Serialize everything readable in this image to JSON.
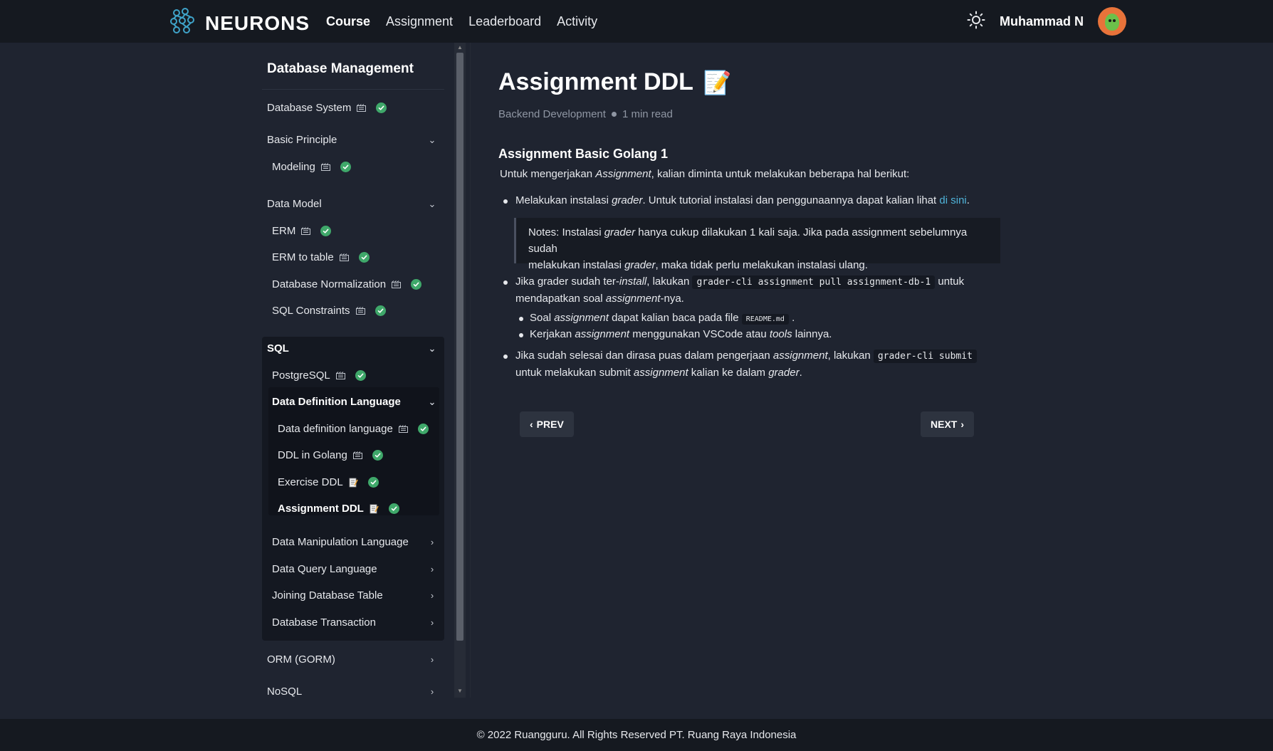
{
  "header": {
    "brand": "NEURONS",
    "nav": [
      "Course",
      "Assignment",
      "Leaderboard",
      "Activity"
    ],
    "active_nav": "Course",
    "user_name": "Muhammad N"
  },
  "sidebar": {
    "title": "Database Management",
    "items": {
      "database_system": "Database System",
      "basic_principle": "Basic Principle",
      "modeling": "Modeling",
      "data_model": "Data Model",
      "erm": "ERM",
      "erm_to_table": "ERM to table",
      "database_normalization": "Database Normalization",
      "sql_constraints": "SQL Constraints",
      "sql": "SQL",
      "postgresql": "PostgreSQL",
      "ddl": "Data Definition Language",
      "ddl_lesson": "Data definition language",
      "ddl_golang": "DDL in Golang",
      "exercise_ddl": "Exercise DDL",
      "assignment_ddl": "Assignment DDL",
      "dml": "Data Manipulation Language",
      "dql": "Data Query Language",
      "joining": "Joining Database Table",
      "transaction": "Database Transaction",
      "orm": "ORM (GORM)",
      "nosql": "NoSQL"
    }
  },
  "main": {
    "title": "Assignment DDL",
    "title_emoji": "📝",
    "category": "Backend Development",
    "read_time": "1 min read",
    "section_title": "Assignment Basic Golang 1",
    "intro_1": "Untuk mengerjakan ",
    "intro_em": "Assignment",
    "intro_2": ", kalian diminta untuk melakukan beberapa hal berikut:",
    "b1_1": "Melakukan instalasi ",
    "b1_em": "grader",
    "b1_2": ". Untuk tutorial instalasi dan penggunaannya dapat kalian lihat ",
    "b1_link": "di sini",
    "b1_3": ".",
    "note_1": "Notes: Instalasi ",
    "note_em1": "grader",
    "note_2": " hanya cukup dilakukan 1 kali saja. Jika pada assignment sebelumnya sudah",
    "note_3": "melakukan instalasi ",
    "note_em2": "grader",
    "note_4": ", maka tidak perlu melakukan instalasi ulang.",
    "b2_1": "Jika grader sudah ter-",
    "b2_em1": "install",
    "b2_2": ", lakukan ",
    "b2_code": "grader-cli assignment pull assignment-db-1",
    "b2_3": " untuk",
    "b2_4": "mendapatkan soal ",
    "b2_em2": "assignment",
    "b2_5": "-nya.",
    "s1_1": "Soal ",
    "s1_em": "assignment",
    "s1_2": " dapat kalian baca pada file ",
    "s1_code": "README.md",
    "s1_3": " .",
    "s2_1": "Kerjakan ",
    "s2_em1": "assignment",
    "s2_2": " menggunakan VSCode atau ",
    "s2_em2": "tools",
    "s2_3": " lainnya.",
    "b3_1": "Jika sudah selesai dan dirasa puas dalam pengerjaan ",
    "b3_em1": "assignment",
    "b3_2": ", lakukan ",
    "b3_code": "grader-cli submit",
    "b3_3": "untuk melakukan submit ",
    "b3_em2": "assignment",
    "b3_4": " kalian ke dalam ",
    "b3_em3": "grader",
    "b3_5": ".",
    "prev_label": "PREV",
    "next_label": "NEXT"
  },
  "footer": {
    "text": "© 2022 Ruangguru. All Rights Reserved PT. Ruang Raya Indonesia"
  },
  "colors": {
    "background": "#1f2430",
    "topbar": "#151920",
    "check": "#3fa86a",
    "link": "#4fb3d9"
  }
}
